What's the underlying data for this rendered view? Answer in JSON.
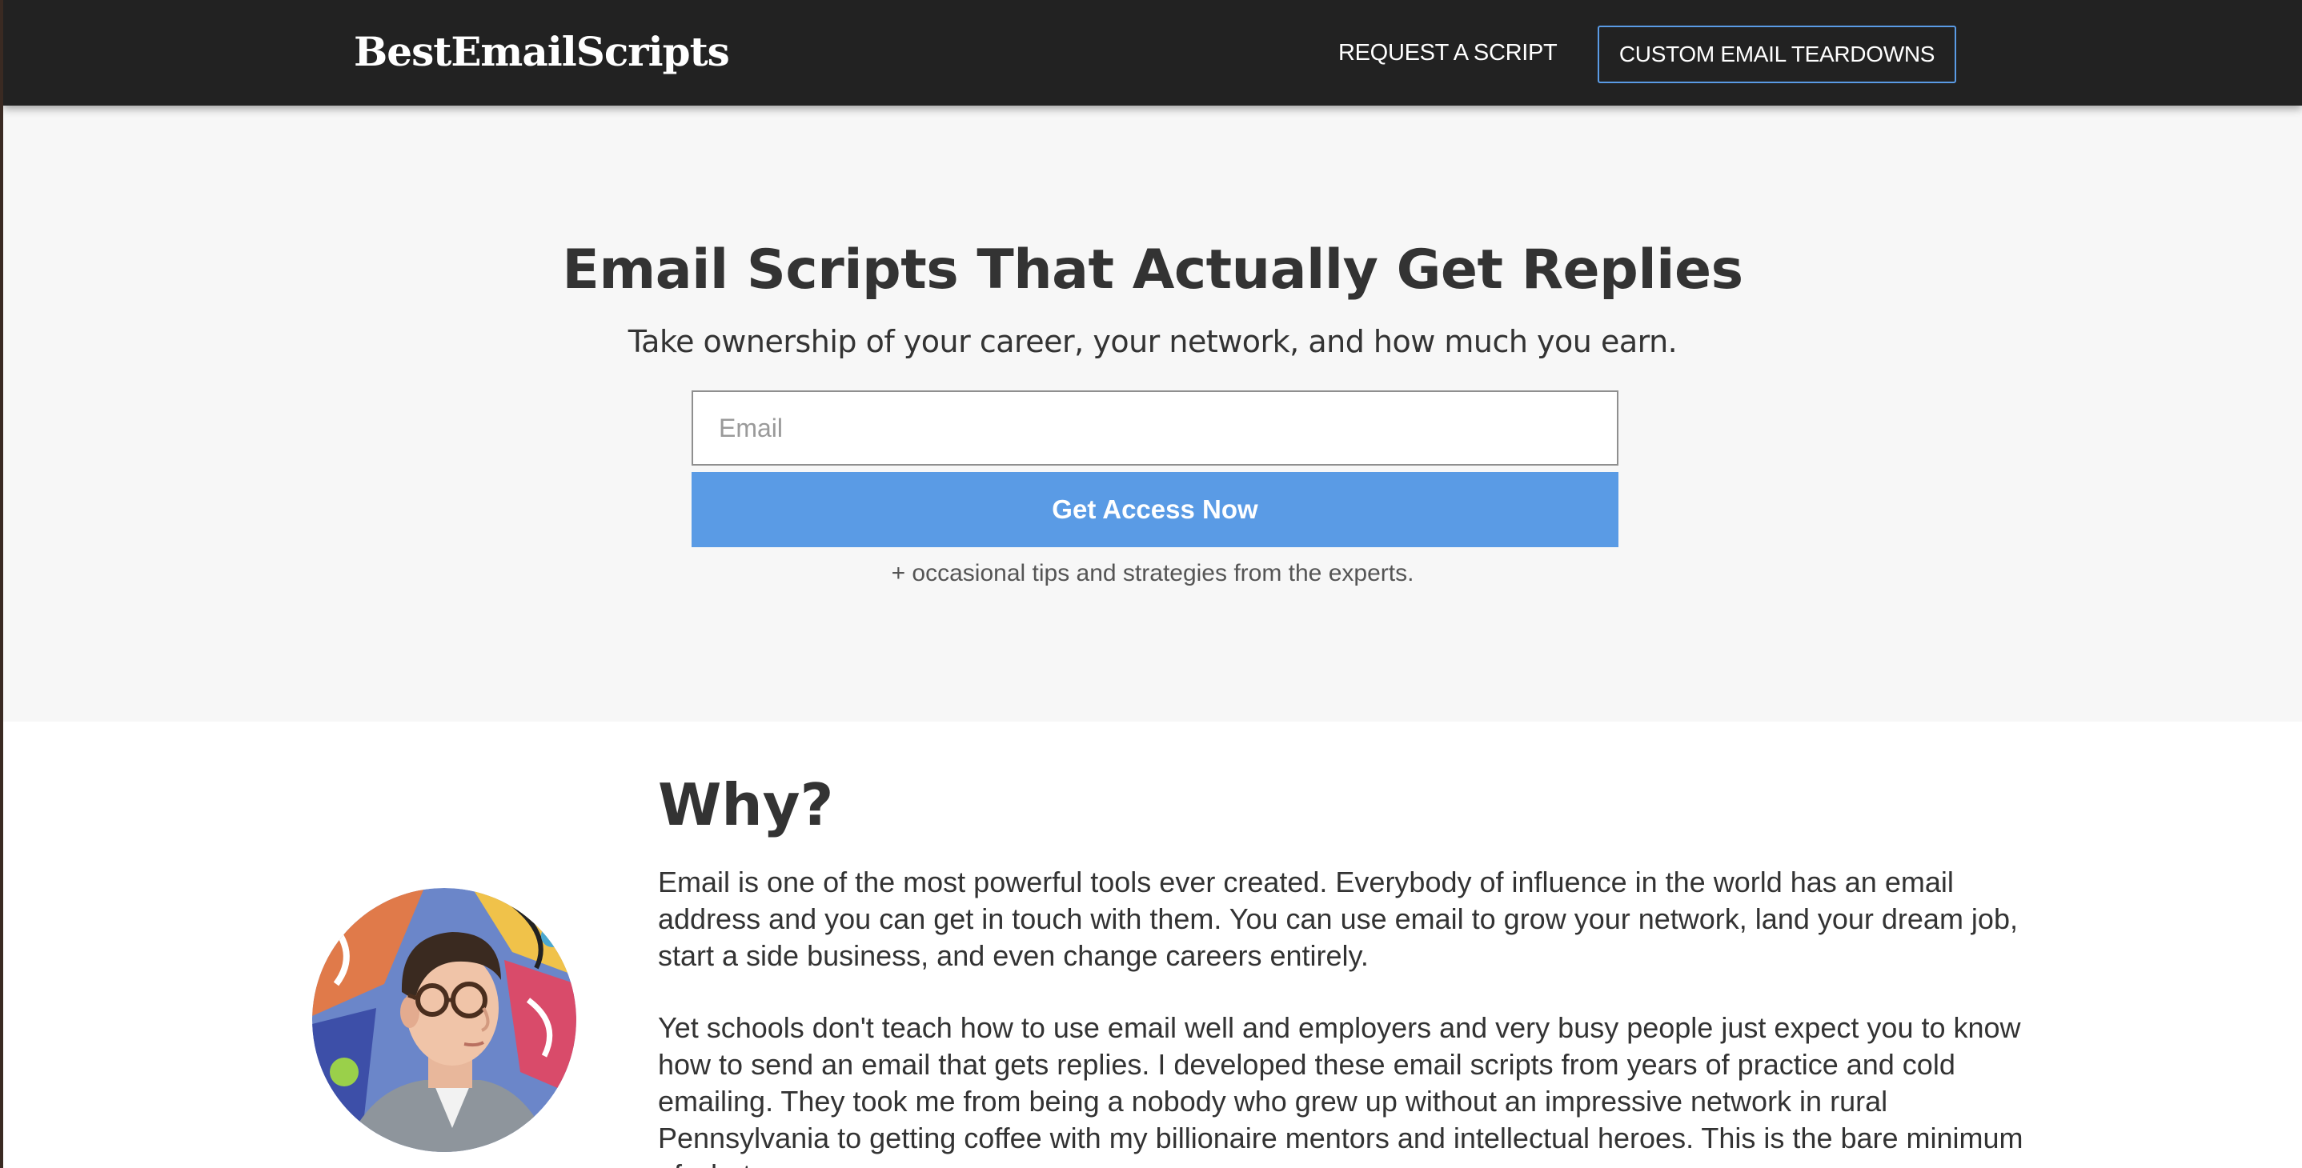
{
  "navbar": {
    "brand": "BestEmailScripts",
    "request_link": "REQUEST A SCRIPT",
    "teardowns_button": "CUSTOM EMAIL TEARDOWNS"
  },
  "hero": {
    "title": "Email Scripts That Actually Get Replies",
    "subtitle": "Take ownership of your career, your network, and how much you earn.",
    "email_placeholder": "Email",
    "email_value": "",
    "cta_label": "Get Access Now",
    "note": "+ occasional tips and strategies from the experts."
  },
  "why": {
    "title": "Why?",
    "paragraphs": [
      "Email is one of the most powerful tools ever created. Everybody of influence in the world has an email address and you can get in touch with them. You can use email to grow your network, land your dream job, start a side business, and even change careers entirely.",
      "Yet schools don't teach how to use email well and employers and very busy people just expect you to know how to send an email that gets replies. I developed these email scripts from years of practice and cold emailing. They took me from being a nobody who grew up without an impressive network in rural Pennsylvania to getting coffee with my billionaire mentors and intellectual heroes. This is the bare minimum of what you"
    ]
  },
  "colors": {
    "navbar_bg": "#222222",
    "accent_blue": "#5a9be5",
    "hero_bg": "#f7f7f7",
    "text_dark": "#333333"
  }
}
